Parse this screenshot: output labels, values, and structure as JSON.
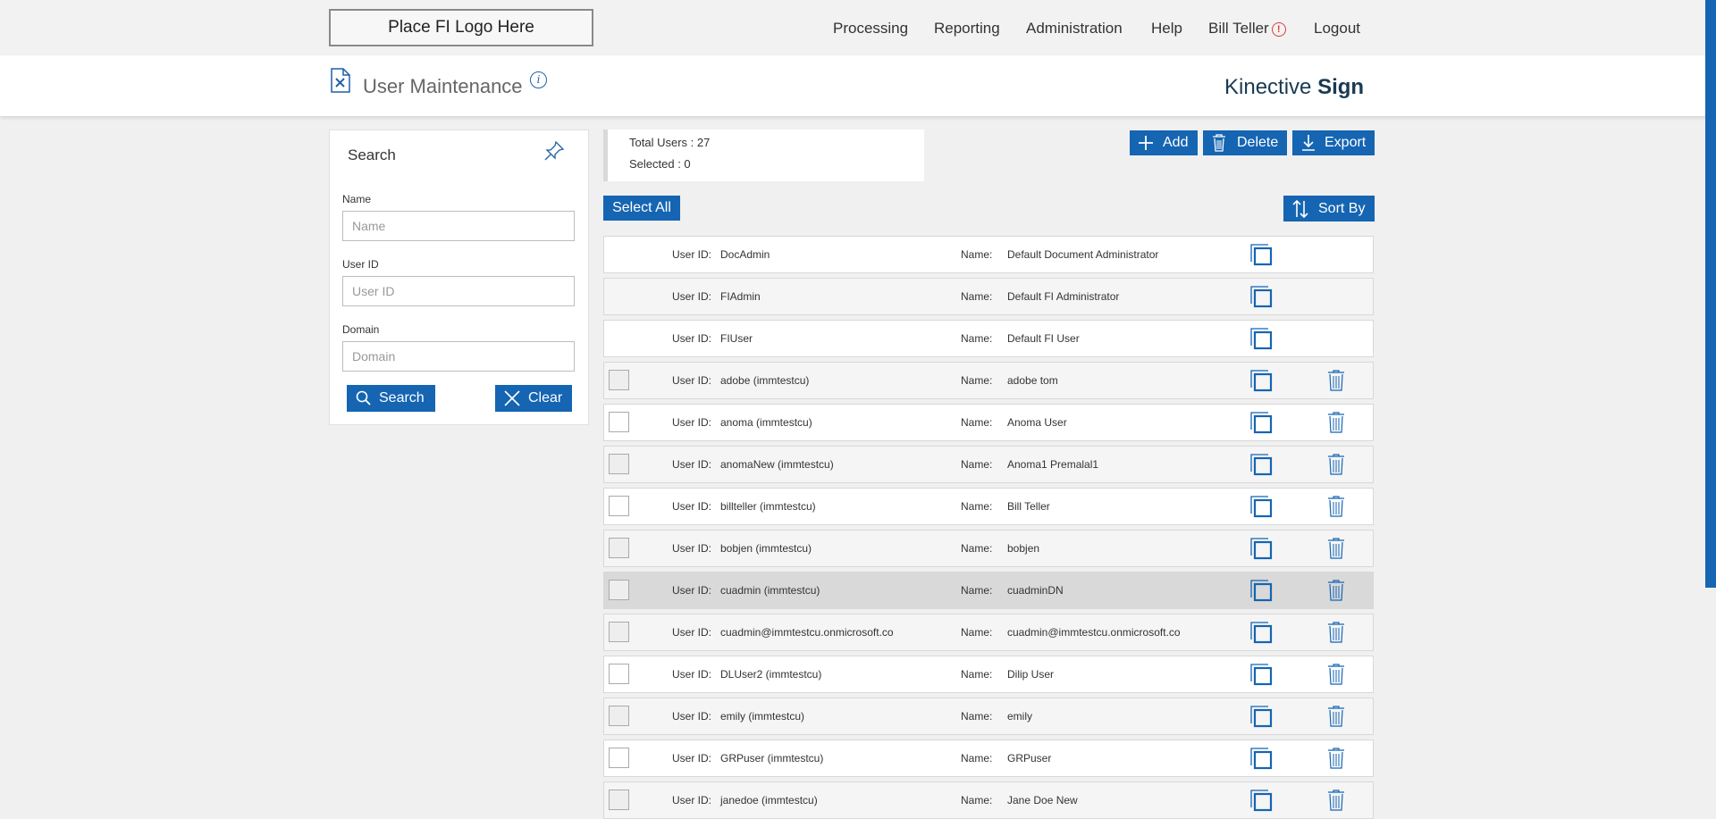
{
  "logo": "Place FI Logo Here",
  "nav": {
    "processing": "Processing",
    "reporting": "Reporting",
    "administration": "Administration",
    "help": "Help",
    "user": "Bill Teller",
    "user_alert_icon": "alert-circle-icon",
    "logout": "Logout"
  },
  "header": {
    "title": "User Maintenance",
    "brand_light": "Kinective ",
    "brand_bold": "Sign"
  },
  "search": {
    "title": "Search",
    "name_label": "Name",
    "name_placeholder": "Name",
    "userid_label": "User ID",
    "userid_placeholder": "User ID",
    "domain_label": "Domain",
    "domain_placeholder": "Domain",
    "search_button": "Search",
    "clear_button": "Clear"
  },
  "summary": {
    "total": "Total Users : 27",
    "selected": "Selected : 0"
  },
  "toolbar": {
    "add": "Add",
    "delete": "Delete",
    "export": "Export",
    "select_all": "Select All",
    "sort_by": "Sort By"
  },
  "list": {
    "userid_label": "User ID:",
    "name_label": "Name:",
    "rows": [
      {
        "user_id": "DocAdmin",
        "name": "Default Document Administrator"
      },
      {
        "user_id": "FIAdmin",
        "name": "Default FI Administrator"
      },
      {
        "user_id": "FIUser",
        "name": "Default FI User"
      },
      {
        "user_id": "adobe (immtestcu)",
        "name": "adobe tom"
      },
      {
        "user_id": "anoma (immtestcu)",
        "name": "Anoma User"
      },
      {
        "user_id": "anomaNew (immtestcu)",
        "name": "Anoma1 Premalal1"
      },
      {
        "user_id": "billteller (immtestcu)",
        "name": "Bill Teller"
      },
      {
        "user_id": "bobjen (immtestcu)",
        "name": "bobjen"
      },
      {
        "user_id": "cuadmin (immtestcu)",
        "name": "cuadminDN"
      },
      {
        "user_id": "cuadmin@immtestcu.onmicrosoft.co",
        "name": "cuadmin@immtestcu.onmicrosoft.co"
      },
      {
        "user_id": "DLUser2 (immtestcu)",
        "name": "Dilip User"
      },
      {
        "user_id": "emily (immtestcu)",
        "name": "emily"
      },
      {
        "user_id": "GRPuser (immtestcu)",
        "name": "GRPuser"
      },
      {
        "user_id": "janedoe (immtestcu)",
        "name": "Jane Doe New"
      }
    ]
  },
  "colors": {
    "accent": "#1565b2",
    "brand_text": "#1a3a52",
    "alert": "#e23b3b"
  }
}
